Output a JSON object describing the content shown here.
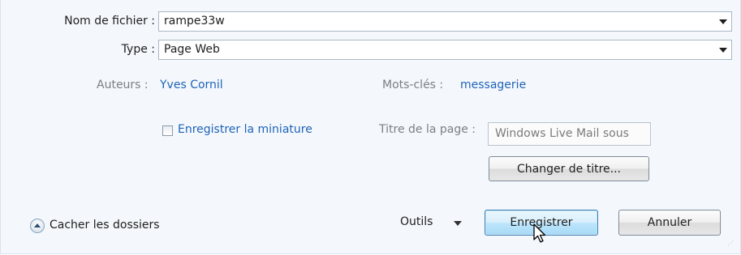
{
  "form": {
    "filename_label": "Nom de fichier :",
    "filename_value": "rampe33w",
    "type_label": "Type :",
    "type_value": "Page Web",
    "authors_label": "Auteurs :",
    "authors_value": "Yves Cornil",
    "keywords_label": "Mots-clés :",
    "keywords_value": "messagerie",
    "thumbnail_label": "Enregistrer la miniature",
    "thumbnail_checked": false,
    "page_title_label": "Titre de la page :",
    "page_title_value": "Windows Live Mail sous",
    "change_title_button": "Changer de titre..."
  },
  "footer": {
    "hide_folders_label": "Cacher les dossiers",
    "tools_label": "Outils",
    "save_button": "Enregistrer",
    "cancel_button": "Annuler"
  },
  "icons": {
    "combo_arrow": "chevron-down-icon",
    "hide_folders": "collapse-up-icon",
    "cursor": "mouse-pointer-icon",
    "resize_grip": "resize-grip-icon"
  },
  "colors": {
    "link_blue": "#1f62b8",
    "default_button": "#bee6fd",
    "dialog_bg": "#f4f8fc"
  }
}
